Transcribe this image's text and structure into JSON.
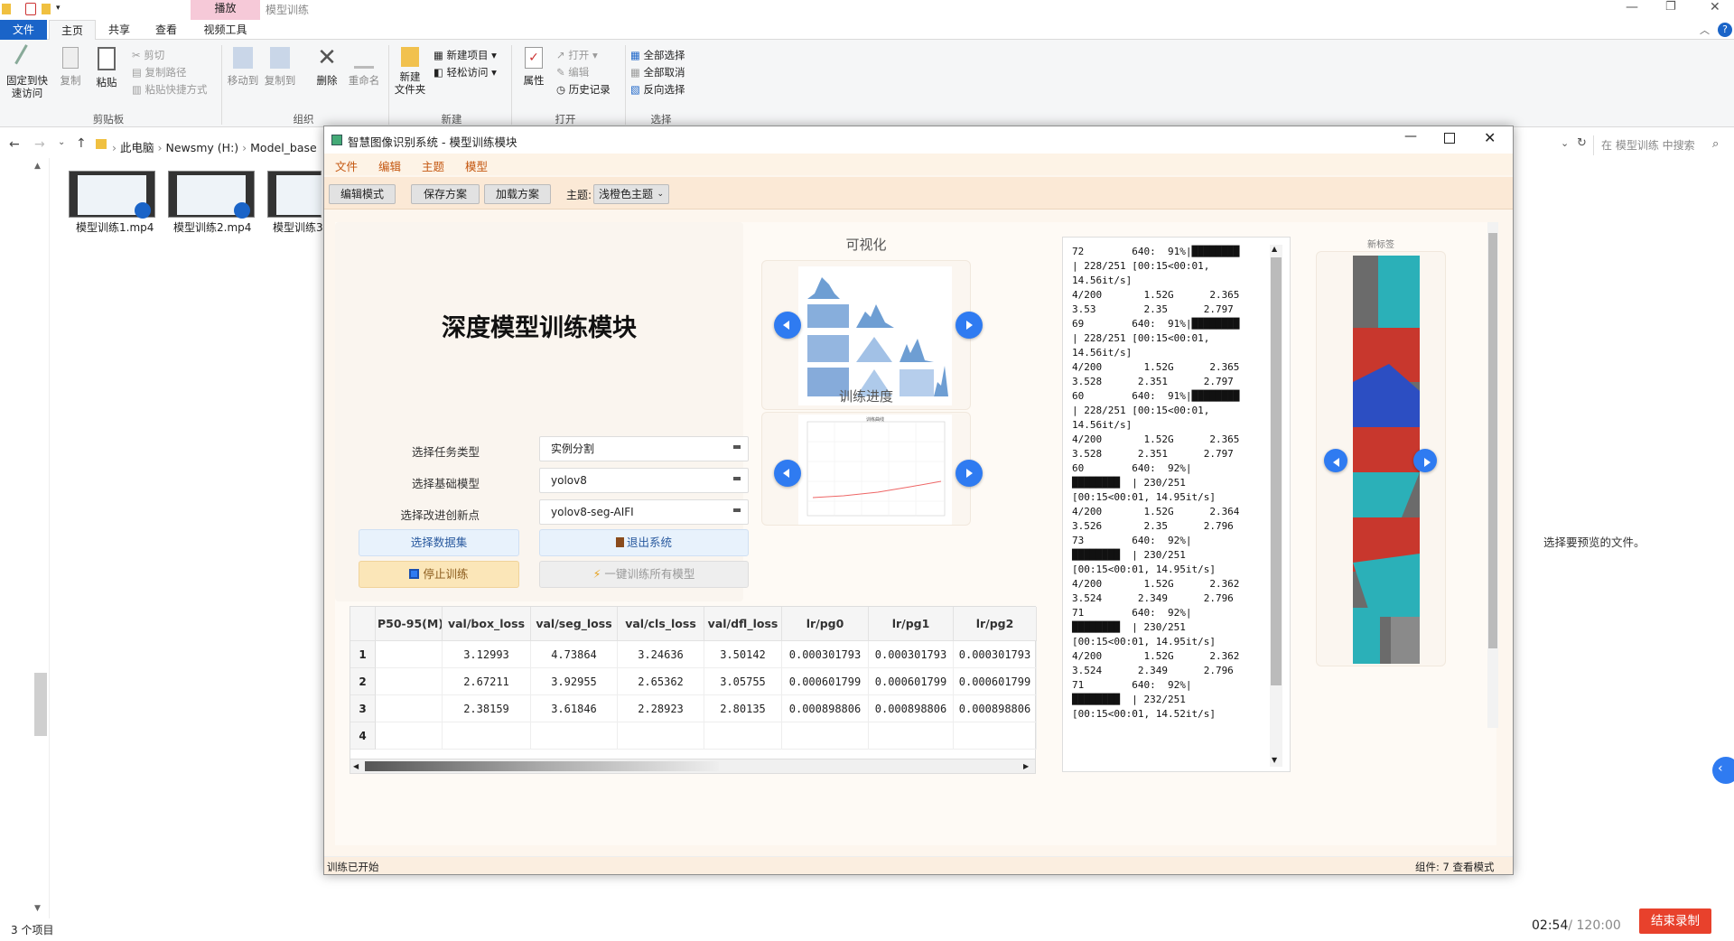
{
  "explorer": {
    "title_tab_context": "播放",
    "title_path": "模型训练",
    "ribbon_tabs": [
      "文件",
      "主页",
      "共享",
      "查看",
      "视频工具"
    ],
    "ribbon": {
      "pin_quick": "固定到快\n速访问",
      "copy": "复制",
      "paste": "粘贴",
      "cut": "剪切",
      "copy_path": "复制路径",
      "paste_shortcut": "粘贴快捷方式",
      "group_clipboard": "剪贴板",
      "move_to": "移动到",
      "copy_to": "复制到",
      "delete": "删除",
      "rename": "重命名",
      "group_organize": "组织",
      "new_folder": "新建\n文件夹",
      "new_item": "新建项目",
      "easy_access": "轻松访问",
      "group_new": "新建",
      "properties": "属性",
      "open": "打开",
      "edit": "编辑",
      "history": "历史记录",
      "group_open": "打开",
      "select_all": "全部选择",
      "select_none": "全部取消",
      "invert_select": "反向选择",
      "group_select": "选择"
    },
    "breadcrumb": [
      "此电脑",
      "Newsmy (H:)",
      "Model_base"
    ],
    "search_placeholder": "在 模型训练 中搜索",
    "files": [
      "模型训练1.mp4",
      "模型训练2.mp4",
      "模型训练3."
    ],
    "item_count": "3 个项目",
    "preview_hint": "选择要预览的文件。"
  },
  "recording": {
    "elapsed": "02:54",
    "total": "/ 120:00",
    "stop_label": "结束录制",
    "accent": "#e8412c"
  },
  "app": {
    "title": "智慧图像识别系统 - 模型训练模块",
    "menus": [
      "文件",
      "编辑",
      "主题",
      "模型"
    ],
    "toolbar": {
      "edit_mode": "编辑模式",
      "save_plan": "保存方案",
      "load_plan": "加载方案",
      "theme_label": "主题:",
      "theme_value": "浅橙色主题"
    },
    "heading": "深度模型训练模块",
    "form": {
      "task_label": "选择任务类型",
      "task_value": "实例分割",
      "model_label": "选择基础模型",
      "model_value": "yolov8",
      "improve_label": "选择改进创新点",
      "improve_value": "yolov8-seg-AIFI"
    },
    "buttons": {
      "select_dataset": "选择数据集",
      "exit": "退出系统",
      "stop_train": "停止训练",
      "train_all": "一键训练所有模型"
    },
    "visual_title": "可视化",
    "progress_title": "训练进度",
    "progress_chart_title": "训练曲线",
    "right_panel_title": "新标签",
    "table": {
      "headers": [
        "P50-95(M)",
        "val/box_loss",
        "val/seg_loss",
        "val/cls_loss",
        "val/dfl_loss",
        "lr/pg0",
        "lr/pg1",
        "lr/pg2"
      ],
      "rows": [
        {
          "num": "1",
          "cells": [
            "",
            "3.12993",
            "4.73864",
            "3.24636",
            "3.50142",
            "0.000301793",
            "0.000301793",
            "0.000301793"
          ]
        },
        {
          "num": "2",
          "cells": [
            "",
            "2.67211",
            "3.92955",
            "2.65362",
            "3.05755",
            "0.000601799",
            "0.000601799",
            "0.000601799"
          ]
        },
        {
          "num": "3",
          "cells": [
            "",
            "2.38159",
            "3.61846",
            "2.28923",
            "2.80135",
            "0.000898806",
            "0.000898806",
            "0.000898806"
          ]
        },
        {
          "num": "4",
          "cells": [
            "",
            "",
            "",
            "",
            "",
            "",
            "",
            ""
          ]
        }
      ]
    },
    "log_text": "72        640:  91%|████████\n| 228/251 [00:15<00:01,\n14.56it/s]\n4/200       1.52G      2.365\n3.53        2.35      2.797\n69        640:  91%|████████\n| 228/251 [00:15<00:01,\n14.56it/s]\n4/200       1.52G      2.365\n3.528      2.351      2.797\n60        640:  91%|████████\n| 228/251 [00:15<00:01,\n14.56it/s]\n4/200       1.52G      2.365\n3.528      2.351      2.797\n60        640:  92%|\n████████  | 230/251\n[00:15<00:01, 14.95it/s]\n4/200       1.52G      2.364\n3.526       2.35      2.796\n73        640:  92%|\n████████  | 230/251\n[00:15<00:01, 14.95it/s]\n4/200       1.52G      2.362\n3.524      2.349      2.796\n71        640:  92%|\n████████  | 230/251\n[00:15<00:01, 14.95it/s]\n4/200       1.52G      2.362\n3.524      2.349      2.796\n71        640:  92%|\n████████  | 232/251\n[00:15<00:01, 14.52it/s]",
    "status_left": "训练已开始",
    "status_right": "组件: 7  查看模式"
  }
}
